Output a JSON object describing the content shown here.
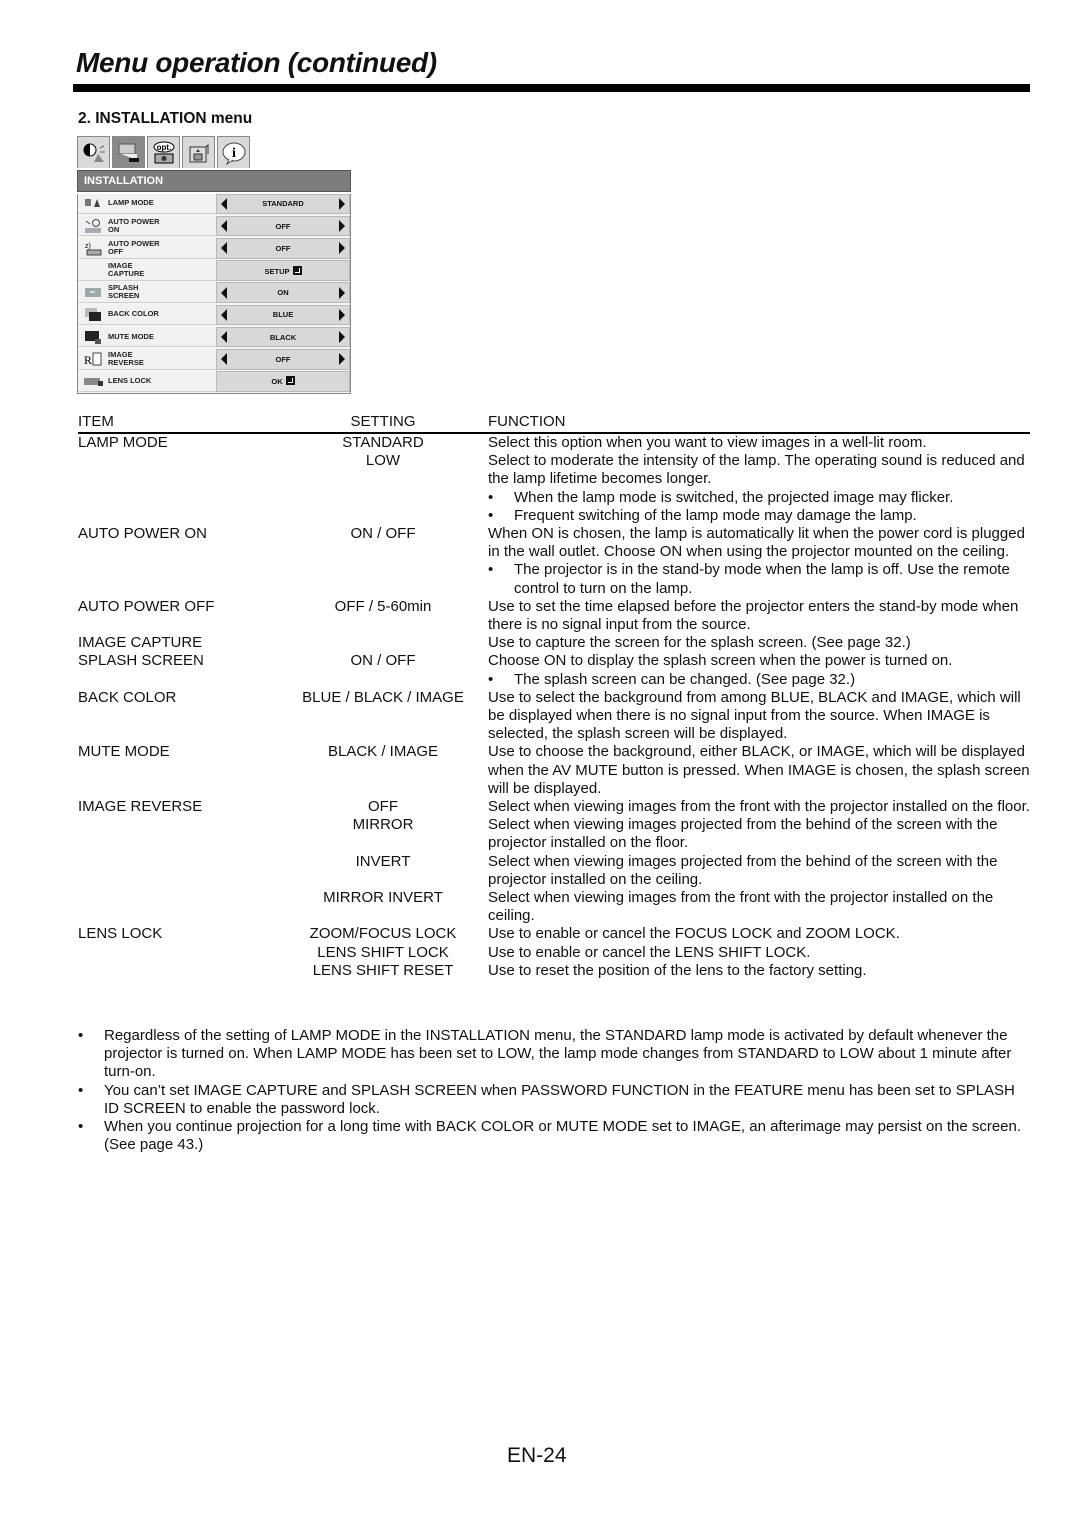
{
  "page_title": "Menu operation (continued)",
  "section_heading": "2. INSTALLATION menu",
  "osd_menu": {
    "tabs": [
      {
        "icon": "picture-adjust-icon",
        "label": ""
      },
      {
        "icon": "installation-icon",
        "label": "",
        "active": true
      },
      {
        "icon": "option-icon",
        "label": "opt."
      },
      {
        "icon": "signal-icon",
        "label": ""
      },
      {
        "icon": "info-icon",
        "label": "i"
      }
    ],
    "header": "INSTALLATION",
    "rows": [
      {
        "icon": "lamp-icon",
        "label_1": "LAMP MODE",
        "label_2": "",
        "value": "STANDARD",
        "arrows": true,
        "enter": false
      },
      {
        "icon": "auto-power-on-icon",
        "label_1": "AUTO POWER",
        "label_2": "ON",
        "value": "OFF",
        "arrows": true,
        "enter": false
      },
      {
        "icon": "auto-power-off-icon",
        "label_1": "AUTO POWER",
        "label_2": "OFF",
        "value": "OFF",
        "arrows": true,
        "enter": false
      },
      {
        "icon": "",
        "label_1": "IMAGE",
        "label_2": "CAPTURE",
        "value": "SETUP",
        "arrows": false,
        "enter": true
      },
      {
        "icon": "splash-screen-icon",
        "label_1": "SPLASH",
        "label_2": "SCREEN",
        "value": "ON",
        "arrows": true,
        "enter": false
      },
      {
        "icon": "back-color-icon",
        "label_1": "BACK COLOR",
        "label_2": "",
        "value": "BLUE",
        "arrows": true,
        "enter": false
      },
      {
        "icon": "mute-mode-icon",
        "label_1": "MUTE MODE",
        "label_2": "",
        "value": "BLACK",
        "arrows": true,
        "enter": false
      },
      {
        "icon": "image-reverse-icon",
        "label_1": "IMAGE",
        "label_2": "REVERSE",
        "value": "OFF",
        "arrows": true,
        "enter": false
      },
      {
        "icon": "lens-lock-icon",
        "label_1": "LENS LOCK",
        "label_2": "",
        "value": "OK",
        "arrows": false,
        "enter": true
      }
    ]
  },
  "table": {
    "headers": {
      "item": "ITEM",
      "setting": "SETTING",
      "function": "FUNCTION"
    },
    "rows": [
      {
        "item": "LAMP MODE",
        "setting": "STANDARD",
        "function": [
          "Select this option when you want to view images in a well-lit room."
        ],
        "bullets": []
      },
      {
        "item": "",
        "setting": "LOW",
        "function": [
          "Select to moderate the intensity of the lamp. The operating sound is reduced and the lamp lifetime becomes longer."
        ],
        "bullets": [
          "When the lamp mode is switched, the projected image may flicker.",
          "Frequent switching of the lamp mode may damage the lamp."
        ]
      },
      {
        "item": "AUTO POWER ON",
        "setting": "ON / OFF",
        "function": [
          "When ON is chosen, the lamp is automatically lit when the power cord is plugged in the wall outlet. Choose ON when using the projector mounted on the ceiling."
        ],
        "bullets": [
          "The projector is in the stand-by mode when the lamp is off. Use the remote control to turn on the lamp."
        ]
      },
      {
        "item": "AUTO POWER OFF",
        "setting": "OFF / 5-60min",
        "function": [
          "Use to set the time elapsed before the projector enters the stand-by mode when there is no signal input from the source."
        ],
        "bullets": []
      },
      {
        "item": "IMAGE CAPTURE",
        "setting": "",
        "function": [
          "Use to capture the screen for the splash screen. (See page 32.)"
        ],
        "bullets": []
      },
      {
        "item": "SPLASH SCREEN",
        "setting": "ON / OFF",
        "function": [
          "Choose ON to display the splash screen when the power is turned on."
        ],
        "bullets": [
          "The splash screen can be changed. (See page 32.)"
        ]
      },
      {
        "item": "BACK COLOR",
        "setting": "BLUE / BLACK / IMAGE",
        "function": [
          "Use to select the background from among BLUE, BLACK and IMAGE, which will be displayed when there is no signal input from the source. When IMAGE is selected, the splash screen will be displayed."
        ],
        "bullets": []
      },
      {
        "item": "MUTE MODE",
        "setting": "BLACK / IMAGE",
        "function": [
          "Use to choose the background, either BLACK, or IMAGE, which will be displayed when the AV MUTE button is pressed. When IMAGE is chosen, the splash screen will be displayed."
        ],
        "bullets": []
      },
      {
        "item": "IMAGE REVERSE",
        "setting": "OFF",
        "function": [
          "Select when viewing images from the front with the projector installed on the floor."
        ],
        "bullets": []
      },
      {
        "item": "",
        "setting": "MIRROR",
        "function": [
          "Select when viewing images projected from the behind of the screen with the projector installed on the floor."
        ],
        "bullets": []
      },
      {
        "item": "",
        "setting": "INVERT",
        "function": [
          "Select when viewing images projected from the behind of the screen with the projector installed on the ceiling."
        ],
        "bullets": []
      },
      {
        "item": "",
        "setting": "MIRROR INVERT",
        "function": [
          "Select when viewing images from the front with the projector installed on the ceiling."
        ],
        "bullets": []
      },
      {
        "item": "LENS LOCK",
        "setting": "ZOOM/FOCUS LOCK",
        "function": [
          "Use to enable or cancel the FOCUS LOCK and ZOOM LOCK."
        ],
        "bullets": []
      },
      {
        "item": "",
        "setting": "LENS SHIFT LOCK",
        "function": [
          "Use to enable or cancel the LENS SHIFT LOCK."
        ],
        "bullets": []
      },
      {
        "item": "",
        "setting": "LENS SHIFT RESET",
        "function": [
          "Use to reset the position of the lens to the factory setting."
        ],
        "bullets": []
      }
    ]
  },
  "notes": [
    "Regardless of the setting of LAMP MODE in the INSTALLATION menu, the STANDARD lamp mode is activated by default whenever the projector is turned on. When LAMP MODE has been set to LOW, the lamp mode changes from STANDARD to LOW about 1 minute after turn-on.",
    "You can’t set IMAGE CAPTURE and SPLASH SCREEN when PASSWORD FUNCTION in the FEATURE menu has been set to SPLASH ID SCREEN to enable the password lock.",
    "When you continue projection for a long time with BACK COLOR or MUTE MODE set to IMAGE, an afterimage may persist on the screen. (See page 43.)"
  ],
  "page_number": "EN-24"
}
